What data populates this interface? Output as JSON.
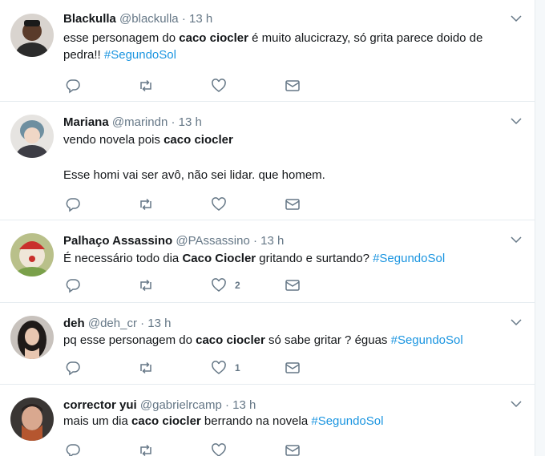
{
  "tweets": [
    {
      "name": "Blackulla",
      "handle": "@blackulla",
      "time": "13 h",
      "text_parts": [
        "esse personagem do ",
        "caco ciocler",
        " é muito alucicrazy, só grita parece doido de pedra!! ",
        "#SegundoSol"
      ],
      "like_count": ""
    },
    {
      "name": "Mariana",
      "handle": "@marindn",
      "time": "13 h",
      "text_parts": [
        "vendo novela pois ",
        "caco ciocler"
      ],
      "text_line2": "Esse homi vai ser avô, não sei lidar. que homem.",
      "like_count": ""
    },
    {
      "name": "Palhaço Assassino",
      "handle": "@PAssassino",
      "time": "13 h",
      "text_parts": [
        "É necessário todo dia ",
        "Caco Ciocler",
        " gritando e surtando? ",
        "#SegundoSol"
      ],
      "like_count": "2"
    },
    {
      "name": "deh",
      "handle": "@deh_cr",
      "time": "13 h",
      "text_parts": [
        "pq esse personagem do ",
        "caco ciocler",
        " só sabe gritar ? éguas ",
        "#SegundoSol"
      ],
      "like_count": "1"
    },
    {
      "name": "corrector yui",
      "handle": "@gabrielrcamp",
      "time": "13 h",
      "text_parts": [
        "mais um dia ",
        "caco ciocler",
        " berrando na novela ",
        "#SegundoSol"
      ],
      "like_count": ""
    }
  ],
  "separator": "·",
  "icons": {
    "reply": "reply-icon",
    "retweet": "retweet-icon",
    "like": "heart-icon",
    "dm": "envelope-icon",
    "menu": "chevron-down-icon"
  },
  "colors": {
    "text": "#14171a",
    "secondary": "#657786",
    "link": "#1b95e0",
    "border": "#e6ecf0"
  }
}
